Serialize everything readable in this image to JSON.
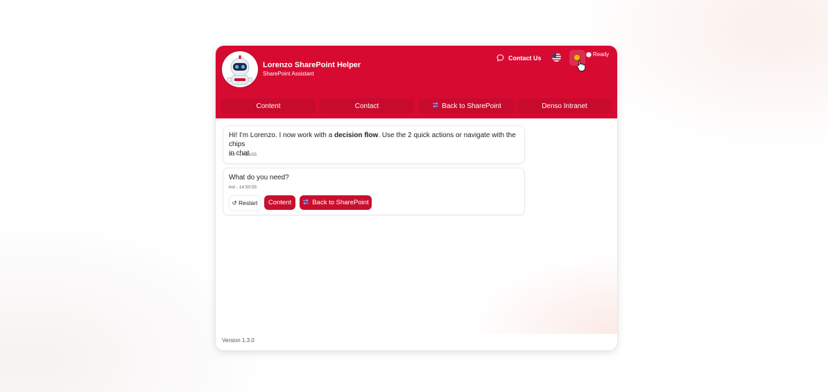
{
  "header": {
    "title": "Lorenzo SharePoint Helper",
    "subtitle": "SharePoint Assistant",
    "contact_label": "Contact Us",
    "status_label": "Ready",
    "avatar_icon": "robot-icon",
    "contact_icon": "chat-bubble-icon",
    "language_icon": "us-flag-icon",
    "theme_icon": "sun-icon",
    "accent_color": "#d70a32"
  },
  "nav": {
    "items": [
      {
        "label": "Content"
      },
      {
        "label": "Contact"
      },
      {
        "label": "Back to SharePoint",
        "icon": "back-arrows-icon"
      },
      {
        "label": "Denso Intranet"
      }
    ]
  },
  "chat": {
    "messages": [
      {
        "text_before": "Hi! I'm Lorenzo. I now work with a ",
        "text_bold": "decision flow",
        "text_after_line1": ". Use the 2 quick actions or navigate with the chips",
        "text_line2": "in chat.",
        "meta": "bot - 14:50:55"
      },
      {
        "text": "What do you need?",
        "meta": "bot - 14:50:55",
        "chips": {
          "restart": "↺ Restart",
          "content": "Content",
          "back": "Back to SharePoint"
        }
      }
    ]
  },
  "footer": {
    "version": "Version 1.3.0"
  }
}
